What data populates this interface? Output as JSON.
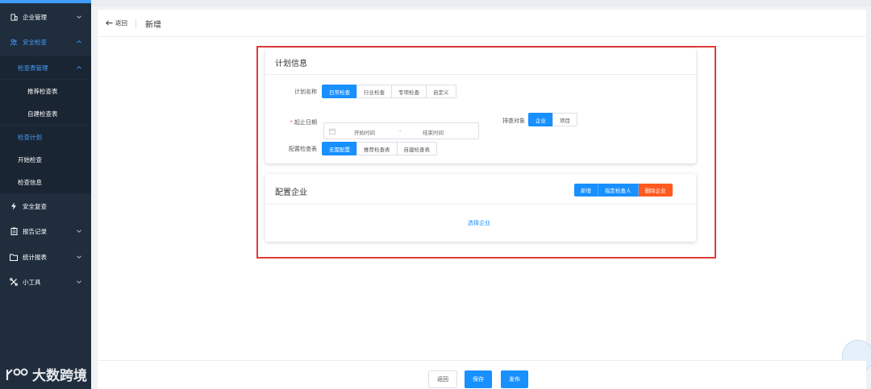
{
  "sidebar": {
    "items": [
      {
        "label": "企业管理",
        "icon": "building-icon"
      },
      {
        "label": "安全检查",
        "icon": "people-icon"
      },
      {
        "label": "检查表管理"
      },
      {
        "label": "推荐检查表"
      },
      {
        "label": "自建检查表"
      },
      {
        "label": "检查计划"
      },
      {
        "label": "开始检查"
      },
      {
        "label": "检查信息"
      },
      {
        "label": "安全复查",
        "icon": "bolt-icon"
      },
      {
        "label": "报告记录",
        "icon": "clipboard-icon"
      },
      {
        "label": "统计报表",
        "icon": "folder-icon"
      },
      {
        "label": "小工具",
        "icon": "tools-icon"
      }
    ]
  },
  "header": {
    "back_label": "返回",
    "title": "新增"
  },
  "plan_card": {
    "title": "计划信息",
    "plan_name_label": "计划名称",
    "plan_name_options": [
      "日常检查",
      "行业检查",
      "专项检查",
      "自定义"
    ],
    "date_label": "起止日期",
    "date_start_placeholder": "开始时间",
    "date_end_placeholder": "结束时间",
    "date_separator": "-",
    "target_label": "排查对象",
    "target_options": [
      "企业",
      "项目"
    ],
    "config_label": "配置检查表",
    "config_options": [
      "无需配置",
      "推荐检查表",
      "自建检查表"
    ]
  },
  "company_card": {
    "title": "配置企业",
    "actions": [
      "新增",
      "指定检查人",
      "删除企业"
    ],
    "select_link": "选择企业"
  },
  "footer": {
    "back_label": "返回",
    "save_label": "保存",
    "publish_label": "发布"
  },
  "watermark": {
    "text": "大数跨境"
  },
  "colors": {
    "sidebar_bg": "#1f2d3d",
    "accent": "#1890ff",
    "danger": "#ff5a1f",
    "highlight_frame": "#e03b3b"
  }
}
